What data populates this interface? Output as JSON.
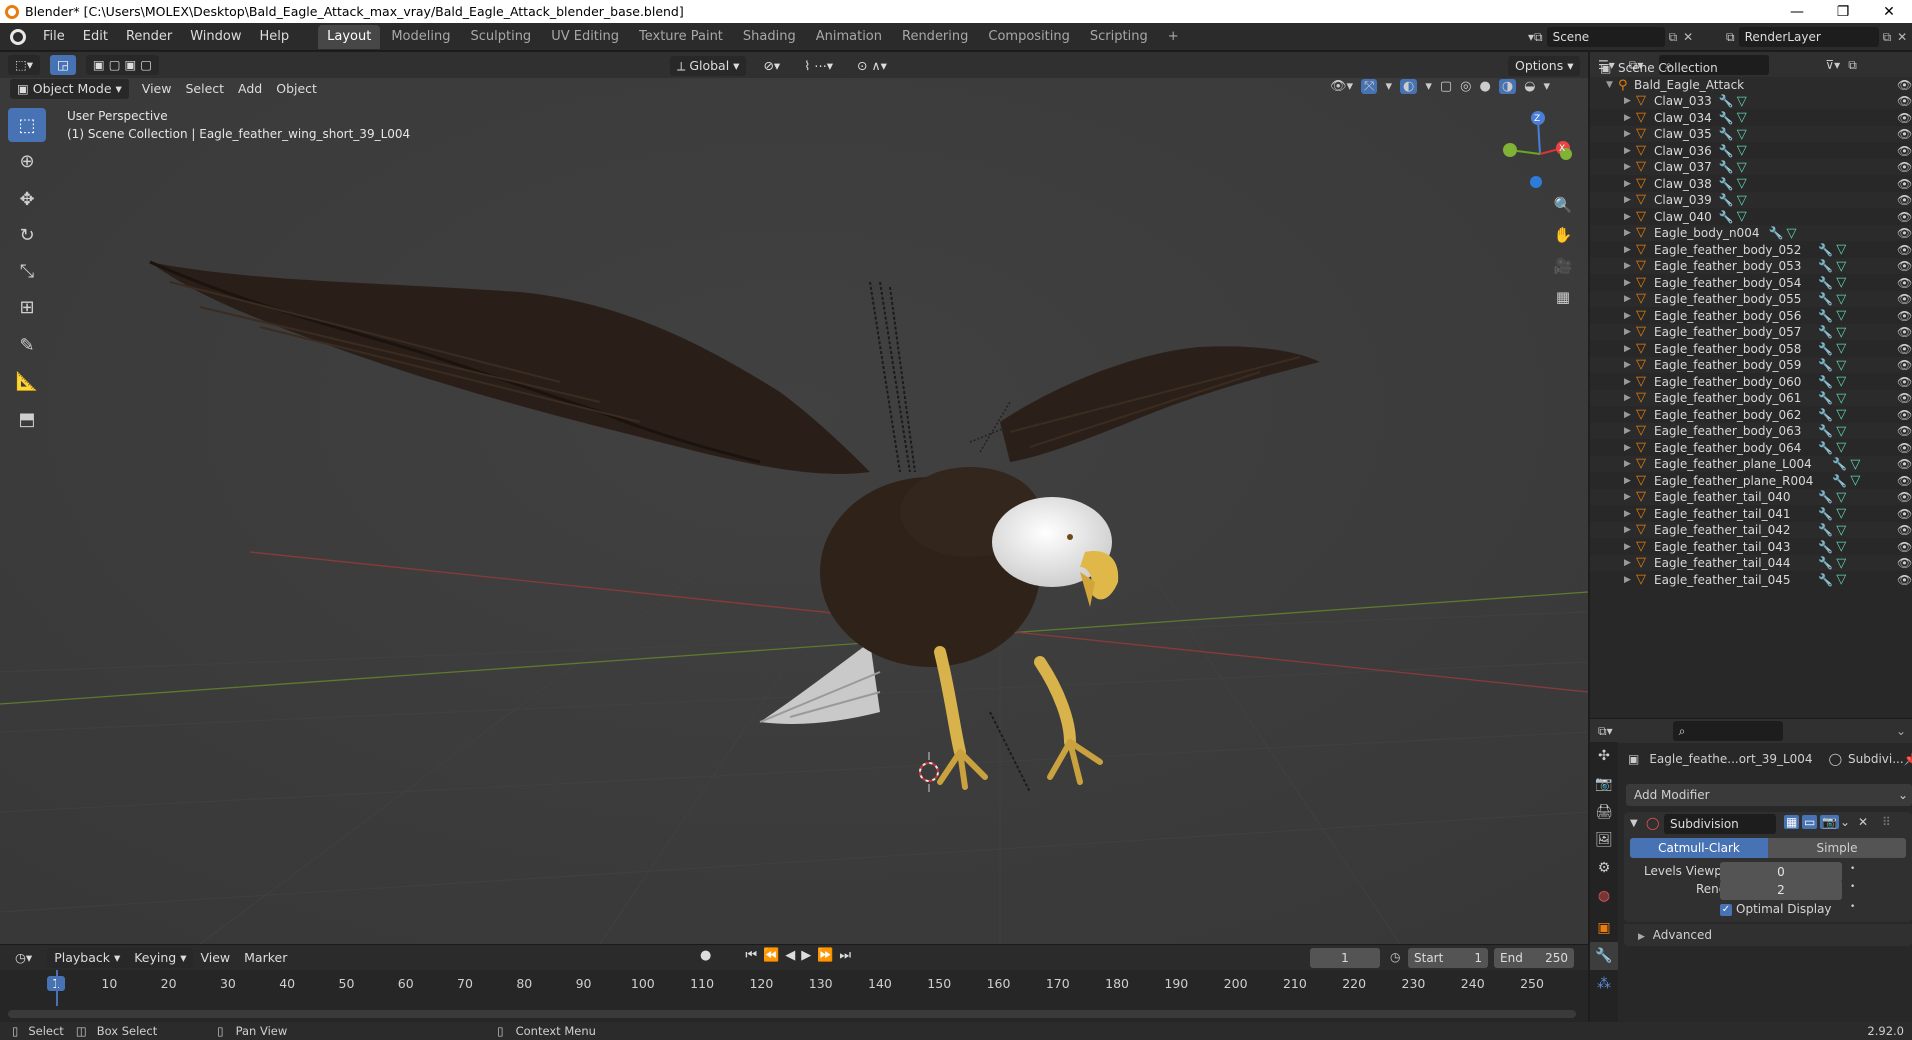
{
  "window": {
    "title": "Blender* [C:\\Users\\MOLEX\\Desktop\\Bald_Eagle_Attack_max_vray/Bald_Eagle_Attack_blender_base.blend]"
  },
  "menu": [
    "File",
    "Edit",
    "Render",
    "Window",
    "Help"
  ],
  "workspaces": [
    "Layout",
    "Modeling",
    "Sculpting",
    "UV Editing",
    "Texture Paint",
    "Shading",
    "Animation",
    "Rendering",
    "Compositing",
    "Scripting"
  ],
  "scene": {
    "name": "Scene",
    "render_layer": "RenderLayer"
  },
  "viewport": {
    "mode": "Object Mode",
    "menus": [
      "View",
      "Select",
      "Add",
      "Object"
    ],
    "transform_orientation": "Global",
    "options_label": "Options",
    "perspective_label": "User Perspective",
    "context_label": "(1) Scene Collection | Eagle_feather_wing_short_39_L004",
    "axis_labels": {
      "z": "Z",
      "x": "X"
    }
  },
  "outliner": {
    "root": "Scene Collection",
    "collection": "Bald_Eagle_Attack",
    "items": [
      "Claw_033",
      "Claw_034",
      "Claw_035",
      "Claw_036",
      "Claw_037",
      "Claw_038",
      "Claw_039",
      "Claw_040",
      "Eagle_body_n004",
      "Eagle_feather_body_052",
      "Eagle_feather_body_053",
      "Eagle_feather_body_054",
      "Eagle_feather_body_055",
      "Eagle_feather_body_056",
      "Eagle_feather_body_057",
      "Eagle_feather_body_058",
      "Eagle_feather_body_059",
      "Eagle_feather_body_060",
      "Eagle_feather_body_061",
      "Eagle_feather_body_062",
      "Eagle_feather_body_063",
      "Eagle_feather_body_064",
      "Eagle_feather_plane_L004",
      "Eagle_feather_plane_R004",
      "Eagle_feather_tail_040",
      "Eagle_feather_tail_041",
      "Eagle_feather_tail_042",
      "Eagle_feather_tail_043",
      "Eagle_feather_tail_044",
      "Eagle_feather_tail_045"
    ]
  },
  "properties": {
    "object_name": "Eagle_feathe...ort_39_L004",
    "modifier_short": "Subdivi...",
    "add_modifier": "Add Modifier",
    "modifier_name": "Subdivision",
    "algorithm_options": [
      "Catmull-Clark",
      "Simple"
    ],
    "selected_algorithm": "Catmull-Clark",
    "levels_viewport_label": "Levels Viewport",
    "levels_viewport": "0",
    "render_label": "Render",
    "render_levels": "2",
    "optimal_display_label": "Optimal Display",
    "optimal_display": true,
    "advanced_label": "Advanced"
  },
  "timeline": {
    "menus": [
      "Playback",
      "Keying",
      "View",
      "Marker"
    ],
    "current_frame": "1",
    "start_label": "Start",
    "start": "1",
    "end_label": "End",
    "end": "250",
    "ticks": [
      "1",
      "10",
      "20",
      "30",
      "40",
      "50",
      "60",
      "70",
      "80",
      "90",
      "100",
      "110",
      "120",
      "130",
      "140",
      "150",
      "160",
      "170",
      "180",
      "190",
      "200",
      "210",
      "220",
      "230",
      "240",
      "250"
    ]
  },
  "statusbar": {
    "select": "Select",
    "box_select": "Box Select",
    "pan_view": "Pan View",
    "context_menu": "Context Menu",
    "version": "2.92.0"
  },
  "colors": {
    "accent": "#4772b3",
    "orange": "#e87d0d",
    "mesh": "#5fd3b0",
    "modifier": "#7ea0d8"
  }
}
